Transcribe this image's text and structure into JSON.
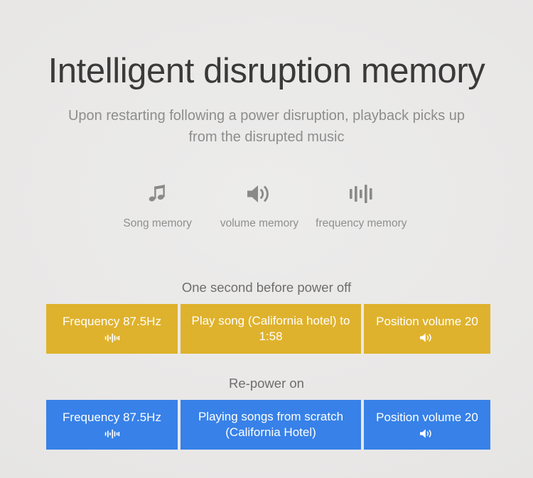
{
  "header": {
    "title": "Intelligent disruption memory",
    "subtitle": "Upon restarting following a power disruption, playback picks up from the disrupted music"
  },
  "features": [
    {
      "icon": "music-note-icon",
      "label": "Song memory"
    },
    {
      "icon": "speaker-volume-icon",
      "label": "volume memory"
    },
    {
      "icon": "equalizer-icon",
      "label": "frequency memory"
    }
  ],
  "groups": [
    {
      "id": "power-off",
      "caption": "One second before power off",
      "color": "#dfb22d",
      "cells": [
        {
          "text": "Frequency 87.5Hz",
          "icon": "equalizer-icon"
        },
        {
          "text": "Play song (California hotel) to 1:58",
          "icon": "none"
        },
        {
          "text": "Position volume 20",
          "icon": "speaker-volume-icon"
        }
      ]
    },
    {
      "id": "re-power-on",
      "caption": "Re-power on",
      "color": "#3781e8",
      "cells": [
        {
          "text": "Frequency 87.5Hz",
          "icon": "equalizer-icon"
        },
        {
          "text": "Playing songs from scratch (California Hotel)",
          "icon": "none"
        },
        {
          "text": "Position volume 20",
          "icon": "speaker-volume-icon"
        }
      ]
    }
  ],
  "colors": {
    "background": "#e9e8e7",
    "title_text": "#3a3a3a",
    "subtitle_text": "#8d8d8d",
    "feature_text": "#8f8f8f",
    "caption_text": "#6d6d6d",
    "icon_grey": "#8a8a8a",
    "accent_yellow": "#dfb22d",
    "accent_blue": "#3781e8",
    "cell_text": "#ffffff"
  }
}
